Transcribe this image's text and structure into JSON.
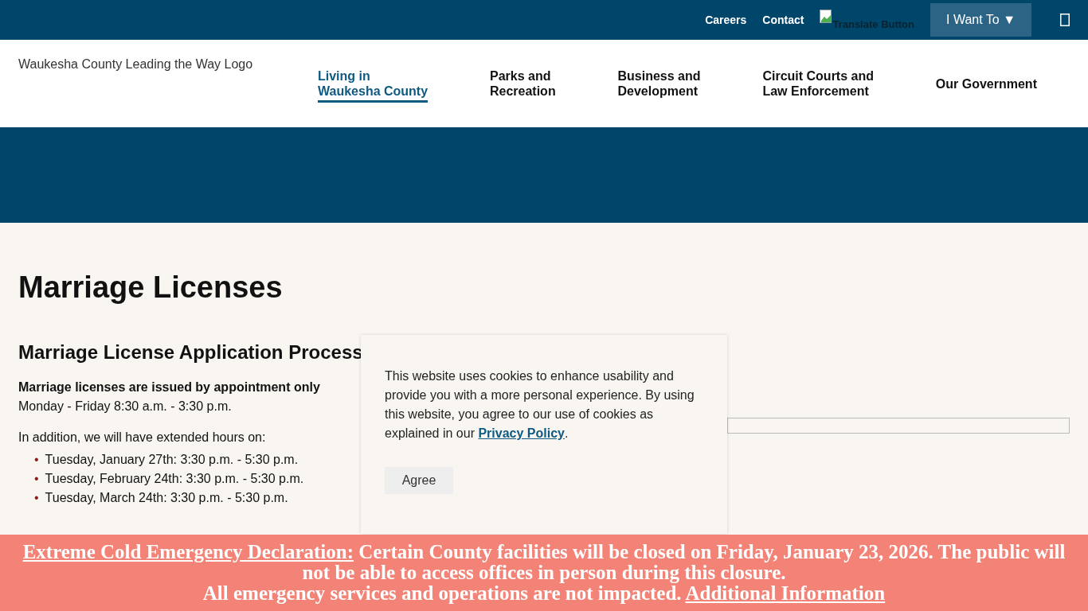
{
  "utility_bar": {
    "links": [
      "Careers",
      "Contact"
    ],
    "translate_alt": "Translate Button",
    "menu_button": "I Want To ▼"
  },
  "header": {
    "logo_alt": "Waukesha County Leading the Way Logo",
    "nav": [
      {
        "lines": [
          "Living in",
          "Waukesha County"
        ],
        "selected": true
      },
      {
        "lines": [
          "Parks and",
          "Recreation"
        ],
        "selected": false
      },
      {
        "lines": [
          "Business and",
          "Development"
        ],
        "selected": false
      },
      {
        "lines": [
          "Circuit Courts and",
          "Law Enforcement"
        ],
        "selected": false
      },
      {
        "lines": [
          "Our Government"
        ],
        "selected": false
      }
    ]
  },
  "page": {
    "title": "Marriage Licenses",
    "section_heading": "Marriage License Application Process",
    "bold_note": "Marriage licenses are issued by appointment only",
    "hours": "Monday - Friday 8:30 a.m. - 3:30 p.m.",
    "intro": "In addition, we will have extended hours on:",
    "bullet": "•",
    "dates": [
      "Tuesday, January 27th: 3:30 p.m. - 5:30 p.m.",
      "Tuesday, February 24th: 3:30 p.m. - 5:30 p.m.",
      "Tuesday, March 24th: 3:30 p.m. - 5:30 p.m."
    ]
  },
  "cookie_notice": {
    "text": "This website uses cookies to enhance usability and provide you with a more personal experience. By using this website, you agree to our use of cookies as explained in our ",
    "link": "Privacy Policy",
    "after": ".",
    "button": "Agree"
  },
  "alert_banner": {
    "link": "Extreme Cold Emergency Declaration:",
    "text": "Certain County facilities will be closed on Friday, January 23, 2026. The public will not be able to access offices in person during this closure.",
    "text2": "All emergency services and operations are not impacted.",
    "more_link": "Additional Information"
  }
}
